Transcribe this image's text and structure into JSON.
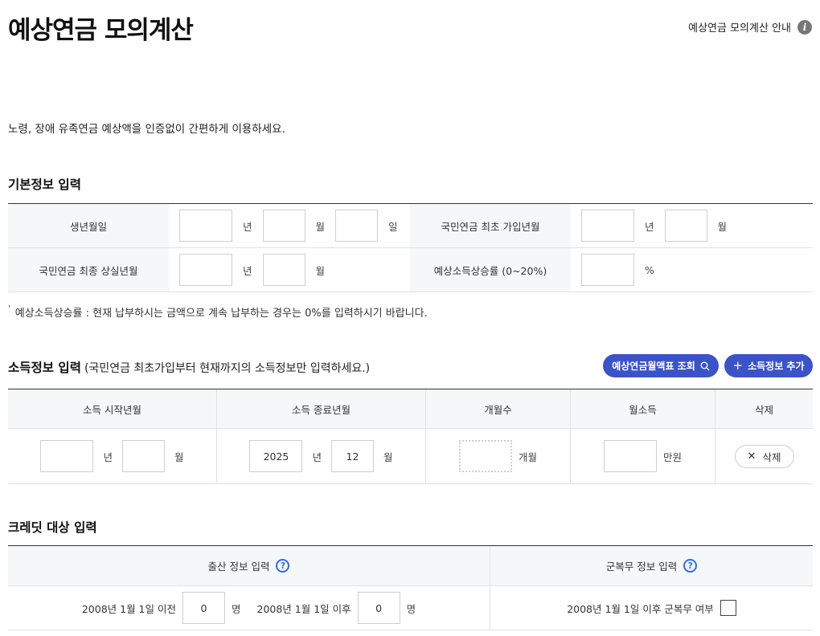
{
  "header": {
    "title": "예상연금 모의계산",
    "guide_label": "예상연금 모의계산 안내",
    "guide_icon": "info-icon"
  },
  "intro_text": "노령, 장애 유족연금 예상액을 인증없이 간편하게 이용하세요.",
  "basic_section": {
    "title": "기본정보 입력",
    "birth_label": "생년월일",
    "first_join_label": "국민연금 최초 가입년월",
    "last_loss_label": "국민연금 최종 상실년월",
    "income_rate_label": "예상소득상승률 (0~20%)",
    "unit_year": "년",
    "unit_month": "월",
    "unit_day": "일",
    "unit_percent": "%",
    "birth_year": "",
    "birth_month": "",
    "birth_day": "",
    "first_join_year": "",
    "first_join_month": "",
    "last_loss_year": "",
    "last_loss_month": "",
    "income_rate": ""
  },
  "note_text": "예상소득상승률 : 현재 납부하시는 금액으로 계속 납부하는 경우는 0%를 입력하시기 바랍니다.",
  "income_section": {
    "title": "소득정보 입력",
    "subtitle": "(국민연금 최초가입부터 현재까지의 소득정보만 입력하세요.)",
    "lookup_button": "예상연금월액표 조회",
    "add_button": "소득정보 추가",
    "columns": [
      "소득 시작년월",
      "소득 종료년월",
      "개월수",
      "월소득",
      "삭제"
    ],
    "row": {
      "start_year": "",
      "start_month": "",
      "end_year": "2025",
      "end_month": "12",
      "months_unit": "개월",
      "income_unit": "만원",
      "income": "",
      "delete_label": "삭제"
    }
  },
  "credit_section": {
    "title": "크레딧 대상 입력",
    "birth_info_label": "출산 정보 입력",
    "military_info_label": "군복무 정보 입력",
    "before_2008_label": "2008년 1월 1일 이전",
    "before_2008_value": "0",
    "after_2008_label": "2008년 1월 1일 이후",
    "after_2008_value": "0",
    "person_unit": "명",
    "military_label": "2008년 1월 1일 이후 군복무 여부",
    "military_checked": false
  },
  "colors": {
    "accent": "#3c53c7",
    "help": "#2f6fd6",
    "label_bg": "#f6f7f9"
  }
}
